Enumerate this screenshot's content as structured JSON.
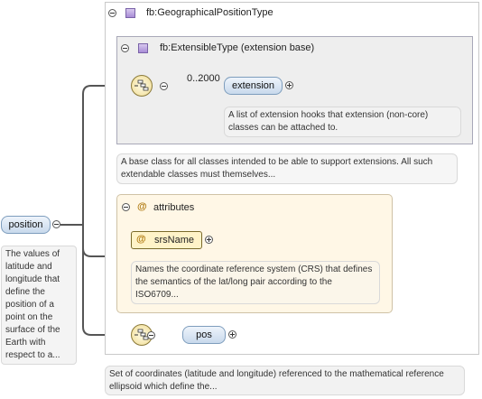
{
  "root_type": {
    "label": "fb:GeographicalPositionType"
  },
  "base_type": {
    "label": "fb:ExtensibleType (extension base)"
  },
  "extension": {
    "occurrence": "0..2000",
    "label": "extension",
    "doc": "A list of extension hooks that extension (non-core) classes can be attached to."
  },
  "base_doc": "A base class for all classes intended to be able to support extensions. All such extendable classes must themselves...",
  "attributes": {
    "header": "attributes",
    "srs_name": {
      "label": "srsName"
    },
    "doc": "Names the coordinate reference system (CRS) that defines the semantics of the lat/long pair according to the ISO6709..."
  },
  "pos": {
    "label": "pos"
  },
  "root_doc": "Set of coordinates (latitude and longitude) referenced to the mathematical reference ellipsoid which define the...",
  "position": {
    "label": "position",
    "doc": "The values of latitude and longitude that define the position of a point on the surface of the Earth with respect to a..."
  },
  "icons": {
    "collapse": "collapse-icon",
    "expand": "expand-icon",
    "complex_type": "complex-type-icon",
    "sequence": "sequence-compositor-icon",
    "attribute": "attribute-icon"
  },
  "colors": {
    "element_fill": "#c8d9ec",
    "attribute_panel": "#fff7e6",
    "base_panel": "#eeeeee",
    "connector": "#555555"
  }
}
